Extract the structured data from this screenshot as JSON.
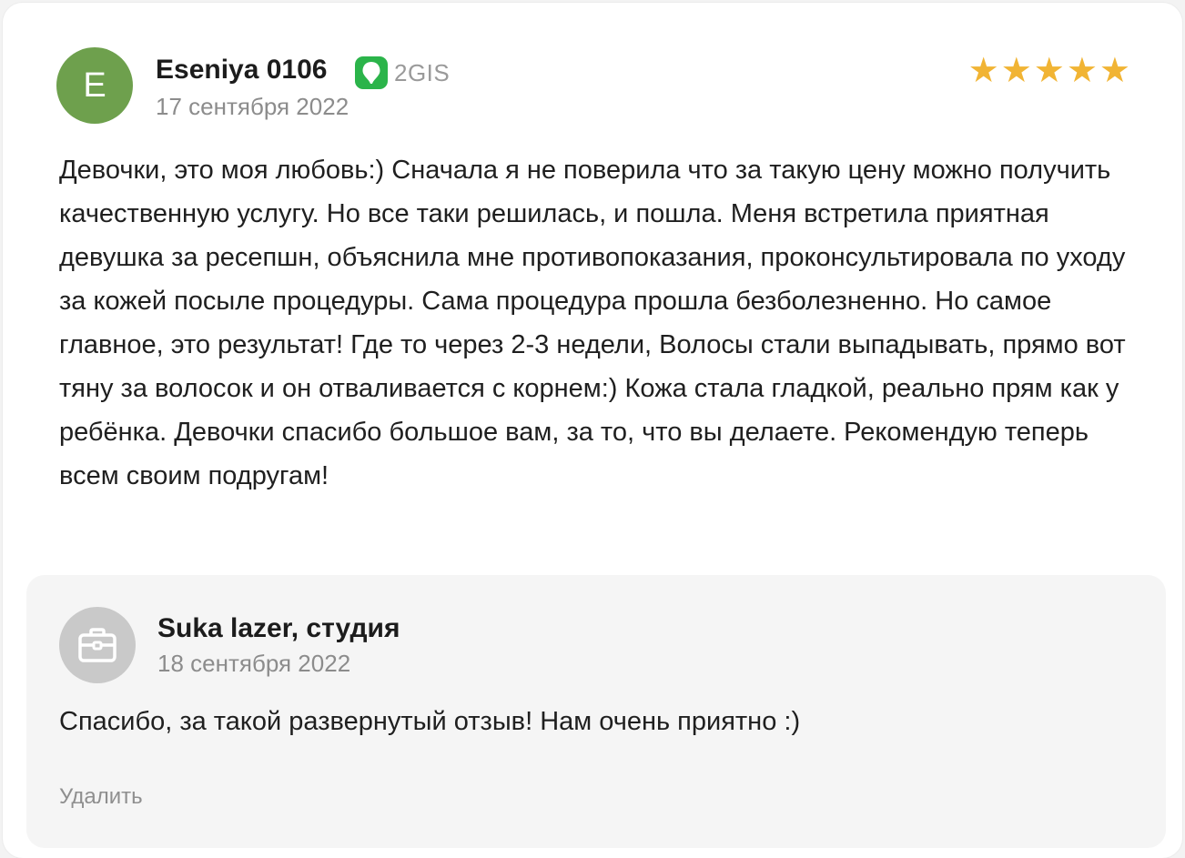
{
  "review": {
    "avatar_letter": "E",
    "avatar_color": "#6ea04d",
    "author": "Eseniya 0106",
    "source": {
      "icon": "2gis-pin-icon",
      "label": "2GIS",
      "color": "#2bb44a"
    },
    "date": "17 сентября 2022",
    "rating": 5,
    "stars": [
      "★",
      "★",
      "★",
      "★",
      "★"
    ],
    "star_color": "#f1b434",
    "text": "Девочки, это моя любовь:) Сначала я не поверила что за такую цену можно получить качественную услугу. Но все таки решилась, и пошла. Меня встретила приятная девушка за ресепшн, объяснила мне противопоказания, проконсультировала по уходу за кожей посыле процедуры. Сама процедура прошла безболезненно. Но самое главное, это результат! Где то через 2-3 недели, Волосы стали выпадывать, прямо вот тяну за волосок и он отваливается с корнем:) Кожа стала гладкой, реально прям как у ребёнка. Девочки спасибо большое вам, за то, что вы делаете. Рекомендую теперь всем своим подругам!"
  },
  "reply": {
    "avatar_icon": "briefcase-icon",
    "author": "Suka lazer, студия",
    "date": "18 сентября 2022",
    "text": "Спасибо, за такой развернутый отзыв! Нам очень приятно :)",
    "delete_label": "Удалить"
  }
}
